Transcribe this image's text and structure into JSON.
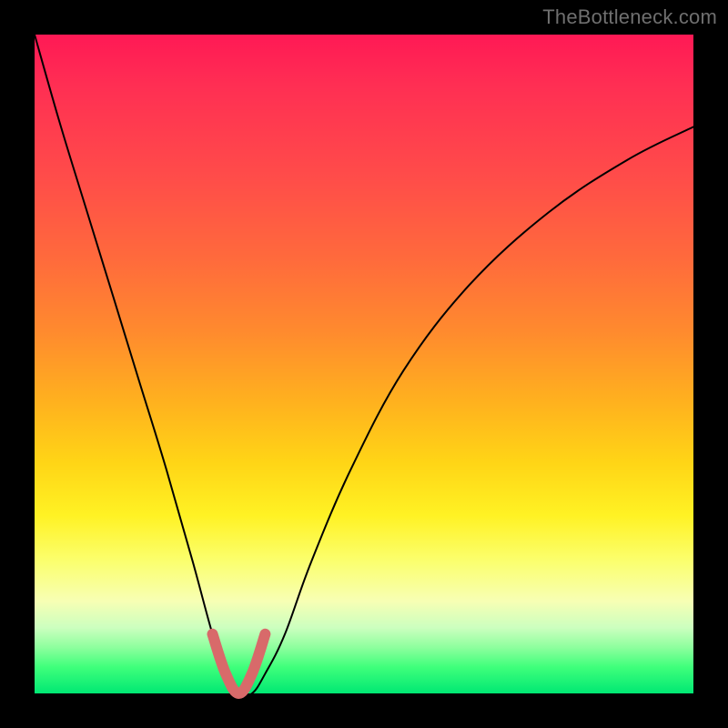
{
  "watermark": "TheBottleneck.com",
  "chart_data": {
    "type": "line",
    "title": "",
    "xlabel": "",
    "ylabel": "",
    "xlim": [
      0,
      100
    ],
    "ylim": [
      0,
      100
    ],
    "series": [
      {
        "name": "main-curve",
        "color": "#000000",
        "stroke_width": 2,
        "x": [
          0,
          4,
          8,
          12,
          16,
          20,
          24,
          27,
          29,
          31,
          33,
          35,
          38,
          42,
          48,
          56,
          66,
          78,
          90,
          100
        ],
        "values": [
          100,
          86,
          73,
          60,
          47,
          34,
          20,
          9,
          3,
          0,
          0,
          3,
          9,
          20,
          34,
          49,
          62,
          73,
          81,
          86
        ]
      },
      {
        "name": "highlight-valley",
        "color": "#d86a6a",
        "stroke_width": 12,
        "x": [
          27,
          29,
          31,
          33,
          35
        ],
        "values": [
          9,
          3,
          0,
          3,
          9
        ]
      }
    ]
  }
}
